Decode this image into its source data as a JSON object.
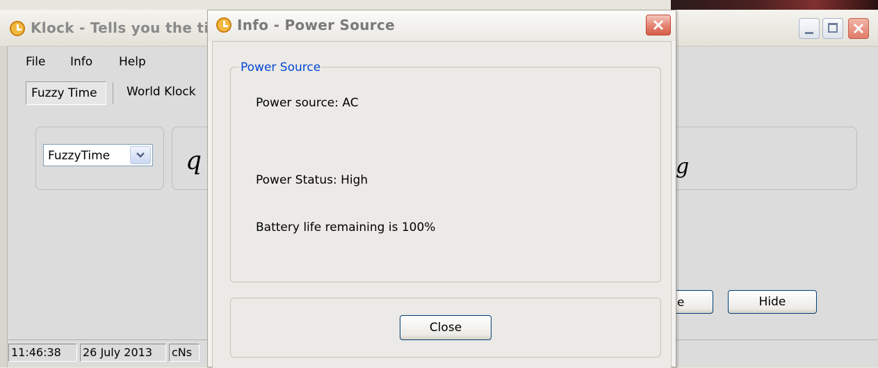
{
  "main_window": {
    "title": "Klock - Tells you the ti",
    "menu": [
      "File",
      "Info",
      "Help"
    ],
    "tabs": [
      "Fuzzy Time",
      "World Klock"
    ],
    "combo_value": "FuzzyTime",
    "display_left_glyph": "q",
    "display_right_glyph": "g",
    "button_partial_label": "e",
    "hide_button_label": "Hide",
    "status_bar": {
      "time": "11:46:38",
      "date": "26 July 2013",
      "extra": "cNs"
    }
  },
  "dialog": {
    "title": "Info - Power Source",
    "group_title": "Power Source",
    "power_source": "Power source: AC",
    "power_status": "Power Status: High",
    "battery": "Battery life remaining is 100%",
    "close_button": "Close"
  },
  "icons": {
    "app_icon": "clock-icon",
    "close_icon": "close-icon",
    "minimize_icon": "minimize-icon",
    "maximize_icon": "maximize-icon",
    "dropdown_icon": "chevron-down-icon"
  },
  "colors": {
    "group_title": "#0046d5",
    "close_red": "#e07b6a",
    "button_border": "#003c74"
  }
}
